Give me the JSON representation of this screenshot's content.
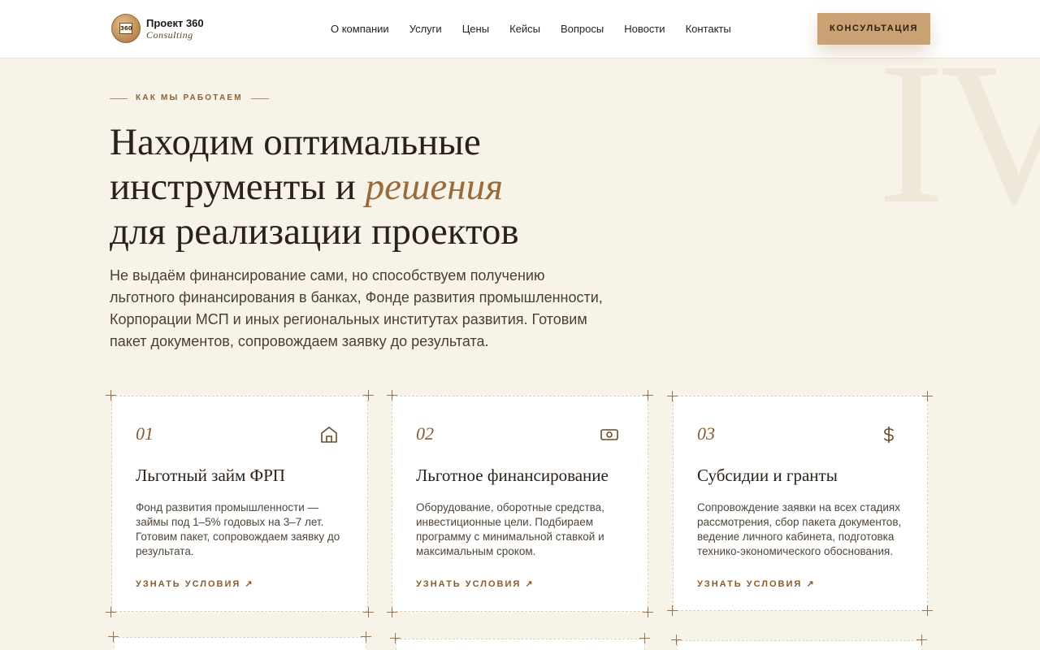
{
  "header": {
    "logo_badge": "360",
    "logo_title": "Проект 360",
    "logo_subtitle": "Consulting",
    "nav": [
      "О компании",
      "Услуги",
      "Цены",
      "Кейсы",
      "Вопросы",
      "Новости",
      "Контакты"
    ],
    "cta": "КОНСУЛЬТАЦИЯ"
  },
  "decor": {
    "numeral": "IV"
  },
  "section": {
    "eyebrow": "КАК МЫ РАБОТАЕМ",
    "headline_line1": "Находим оптимальные",
    "headline_line2_pre": "инструменты и ",
    "headline_accent": "решения",
    "headline_line3": "для реализации проектов",
    "lead": "Не выдаём финансирование сами, но способствуем получению льготного финансирования в банках, Фонде развития промышленности, Корпорации МСП и иных региональных институтах развития. Готовим пакет документов, сопровождаем заявку до результата."
  },
  "cards": [
    {
      "number": "01",
      "icon": "bank-icon",
      "title": "Льготный займ ФРП",
      "text": "Фонд развития промышленности — займы под 1–5% годовых на 3–7 лет. Готовим пакет, сопровождаем заявку до результата.",
      "link": "УЗНАТЬ УСЛОВИЯ ↗"
    },
    {
      "number": "02",
      "icon": "banknote-icon",
      "title": "Льготное финансирование",
      "text": "Оборудование, оборотные средства, инвестиционные цели. Подбираем программу с минимальной ставкой и максимальным сроком.",
      "link": "УЗНАТЬ УСЛОВИЯ ↗"
    },
    {
      "number": "03",
      "icon": "dollar-icon",
      "title": "Субсидии и гранты",
      "text": "Сопровождение заявки на всех стадиях рассмотрения, сбор пакета документов, ведение личного кабинета, подготовка технико-экономического обоснования.",
      "link": "УЗНАТЬ УСЛОВИЯ ↗"
    }
  ],
  "colors": {
    "background": "#f8f3e9",
    "accent": "#caa172",
    "accent_text": "#8a5a2c"
  }
}
